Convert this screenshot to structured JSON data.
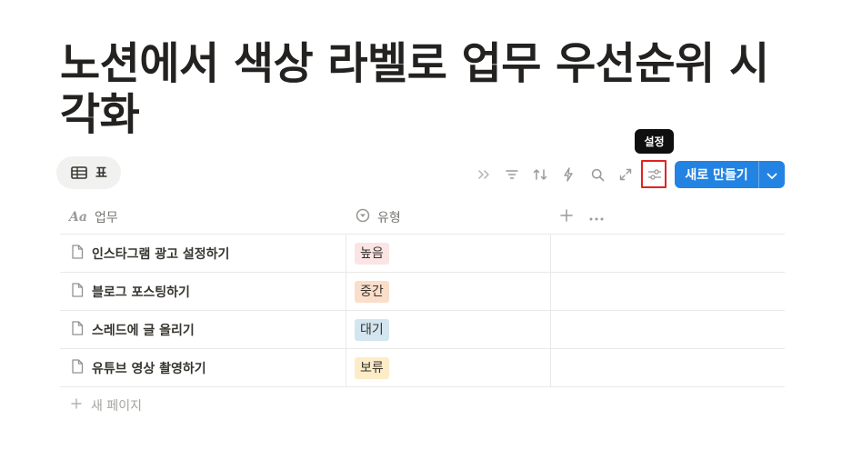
{
  "page": {
    "title": "노션에서 색상 라벨로 업무 우선순위 시각화"
  },
  "view_tab": {
    "icon": "table-icon",
    "label": "표"
  },
  "toolbar": {
    "icons": [
      "double-chevron-right-icon",
      "filter-icon",
      "sort-icon",
      "lightning-icon",
      "search-icon",
      "expand-icon",
      "settings-sliders-icon"
    ],
    "tooltip": "설정",
    "new_button_label": "새로 만들기",
    "accent": "#2383e2",
    "highlight_color": "#e02424"
  },
  "table": {
    "columns": [
      {
        "icon": "text-property-icon",
        "icon_text": "Aa",
        "label": "업무"
      },
      {
        "icon": "select-property-icon",
        "label": "유형"
      }
    ],
    "rows": [
      {
        "name": "인스타그램 광고 설정하기",
        "type": "높음",
        "tag_bg": "#fbe4e4"
      },
      {
        "name": "블로그 포스팅하기",
        "type": "중간",
        "tag_bg": "#fadec9"
      },
      {
        "name": "스레드에 글 올리기",
        "type": "대기",
        "tag_bg": "#d3e5ef"
      },
      {
        "name": "유튜브 영상 촬영하기",
        "type": "보류",
        "tag_bg": "#fdecc8"
      }
    ],
    "new_page_label": "새 페이지"
  }
}
